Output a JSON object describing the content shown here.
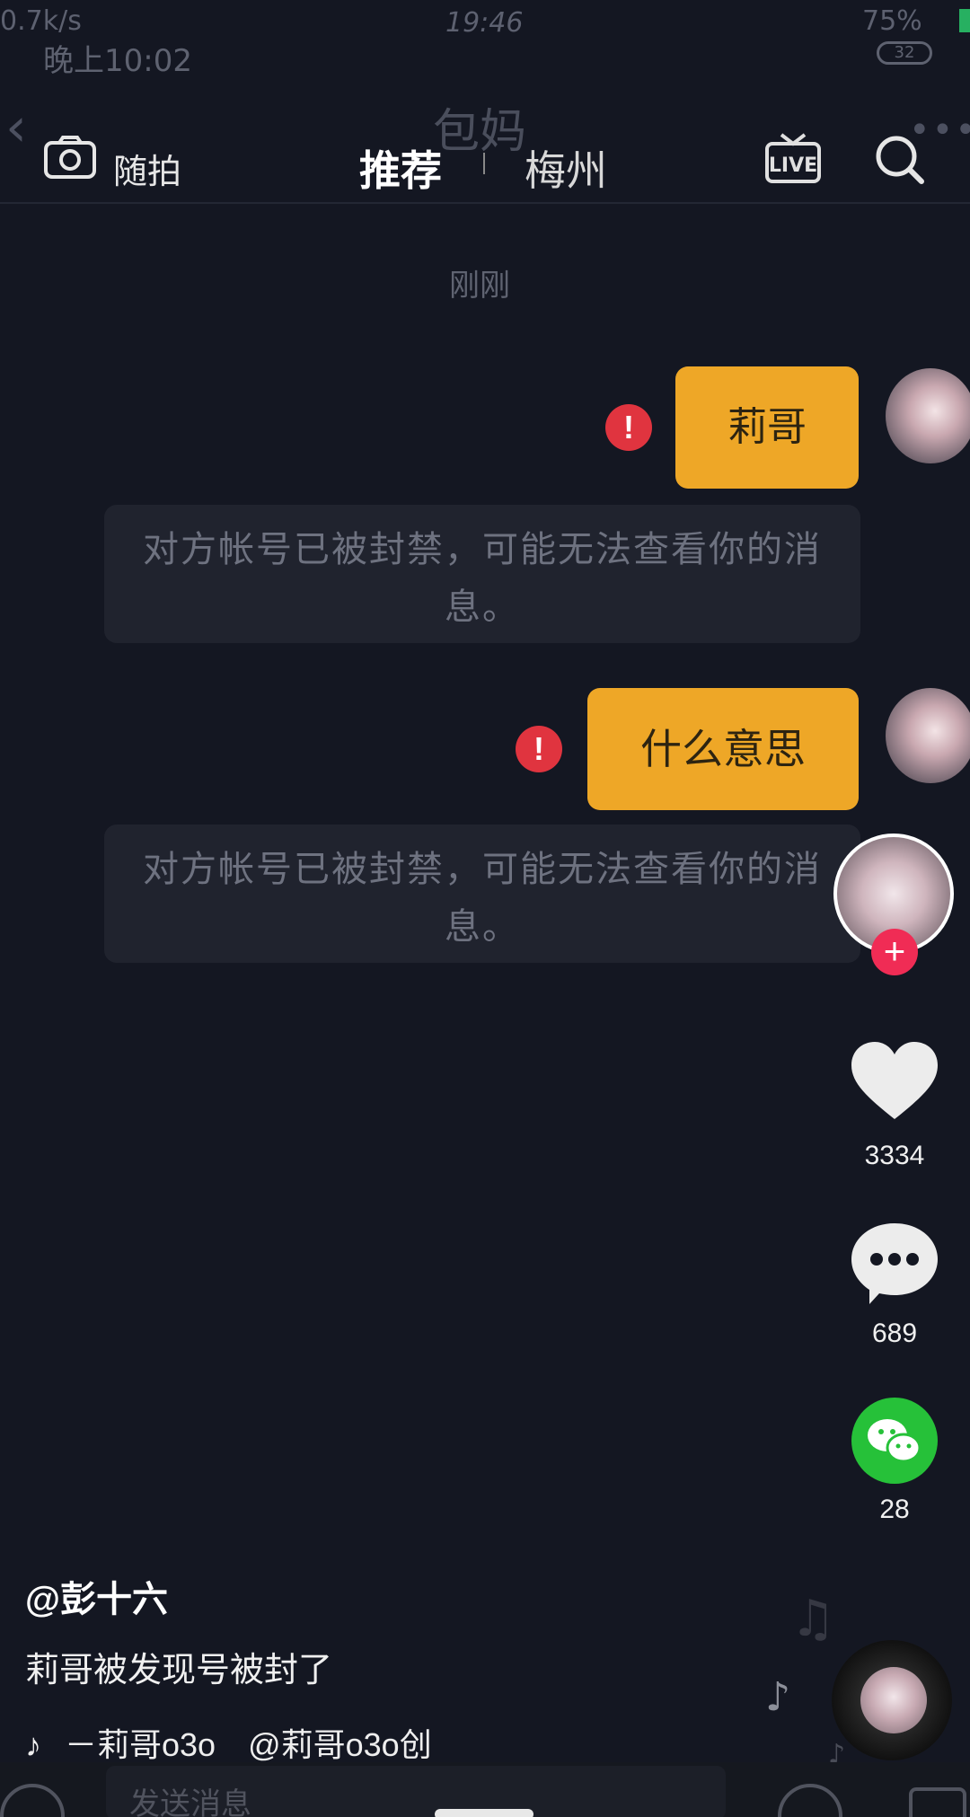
{
  "status_bar": {
    "network_speed": "0.7k/s",
    "center_time": "19:46",
    "battery_top": "75%",
    "time": "晚上10:02",
    "battery_level": "32"
  },
  "chat_header": {
    "contact_name": "包妈"
  },
  "top_nav": {
    "camera_label": "随拍",
    "tabs": [
      {
        "label": "推荐",
        "active": true
      },
      {
        "label": "梅州",
        "active": false
      }
    ]
  },
  "chat": {
    "timestamp": "刚刚",
    "messages": [
      {
        "text": "莉哥",
        "status": "failed",
        "notice": "对方帐号已被封禁，可能无法查看你的消息。"
      },
      {
        "text": "什么意思",
        "status": "failed",
        "notice": "对方帐号已被封禁，可能无法查看你的消息。"
      }
    ]
  },
  "sidebar": {
    "likes": "3334",
    "comments": "689",
    "shares": "28"
  },
  "video_info": {
    "author": "@彭十六",
    "description": "莉哥被发现号被封了",
    "music": "－莉哥o3o　@莉哥o3o创"
  },
  "bottom_input": {
    "placeholder": "发送消息"
  },
  "colors": {
    "background": "#141722",
    "bubble": "#eea727",
    "error": "#e0343f",
    "follow": "#f02c55",
    "wechat": "#26c139"
  }
}
